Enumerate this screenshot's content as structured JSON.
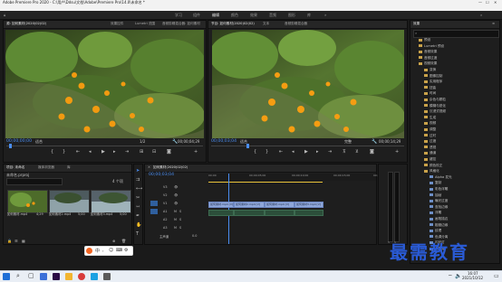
{
  "window": {
    "title": "Adobe Premiere Pro 2020 - C:\\用户\\Ddsu\\文档\\Adobe\\Premiere Pro\\14.0\\未命名 *"
  },
  "menu": [
    "文件(F)",
    "编辑(E)",
    "剪辑(C)",
    "序列(S)",
    "标记(M)",
    "图形(G)",
    "视图(V)",
    "窗口(W)",
    "帮助(H)"
  ],
  "workspaces": [
    "学习",
    "组件",
    "编辑",
    "颜色",
    "效果",
    "音频",
    "图形",
    "库"
  ],
  "source_monitor": {
    "tabs": [
      "源: 如何素材(2020)02(02)",
      "效果控件",
      "Lumetri 范围",
      "音频剪辑混合器: 如何素材"
    ],
    "timecode_left": "00;00;00;00",
    "zoom": "适合",
    "ratio": "1/2",
    "timecode_right": "00;00;04;29"
  },
  "program_monitor": {
    "tabs": [
      "节目: 如何素材(2020)02(02)",
      "文本",
      "音频剪辑混合器"
    ],
    "timecode_left": "00;00;03;04",
    "zoom": "适合",
    "ratio": "完整",
    "timecode_right": "00;00;14;29"
  },
  "project": {
    "tabs": [
      "项目: 未命名",
      "媒体浏览器",
      "库"
    ],
    "file": "未命名.prproj",
    "count": "4 个项",
    "items": [
      {
        "name": "如何素材.mp4",
        "duration": "4;29"
      },
      {
        "name": "如何素材2.mp4",
        "duration": "5;00"
      },
      {
        "name": "如何素材3.mp4",
        "duration": "5;00"
      }
    ]
  },
  "timeline": {
    "tab": "如何素材(2020)02(02)",
    "timecode": "00;00;03;04",
    "ruler": [
      "00;00",
      "00;00;05;00",
      "00;00;10;00",
      "00;00;15;00",
      "00;00;20;00"
    ],
    "tracks": [
      "V3",
      "V2",
      "V1",
      "A1",
      "A2",
      "A3",
      "主声道"
    ],
    "master_value": "0.0",
    "clips": [
      {
        "label": "如何素材.mp4 [V]"
      },
      {
        "label": "如何素材2.mp4 [V]"
      },
      {
        "label": "如何素材.mp4 [V]"
      },
      {
        "label": "如何素材3.mp4 [V]"
      }
    ]
  },
  "effects": {
    "tab": "效果",
    "items": [
      "预设",
      "Lumetri 预设",
      "音频效果",
      "音频过渡",
      "视频效果",
      "变换",
      "图像控制",
      "实用程序",
      "扭曲",
      "时间",
      "杂色与颗粒",
      "模糊与锐化",
      "沉浸式视频",
      "生成",
      "视频",
      "调整",
      "过时",
      "过渡",
      "透视",
      "通道",
      "键控",
      "颜色校正",
      "风格化",
      "Alpha 发光",
      "复制",
      "彩色浮雕",
      "抽帧",
      "曝光过度",
      "查找边缘",
      "浮雕",
      "画笔描边",
      "粗糙边缘",
      "纹理",
      "色调分离",
      "闪光灯",
      "马赛克"
    ]
  },
  "watermark": "最需教育",
  "taskbar": {
    "time": "16:07",
    "date": "2021/10/12"
  }
}
